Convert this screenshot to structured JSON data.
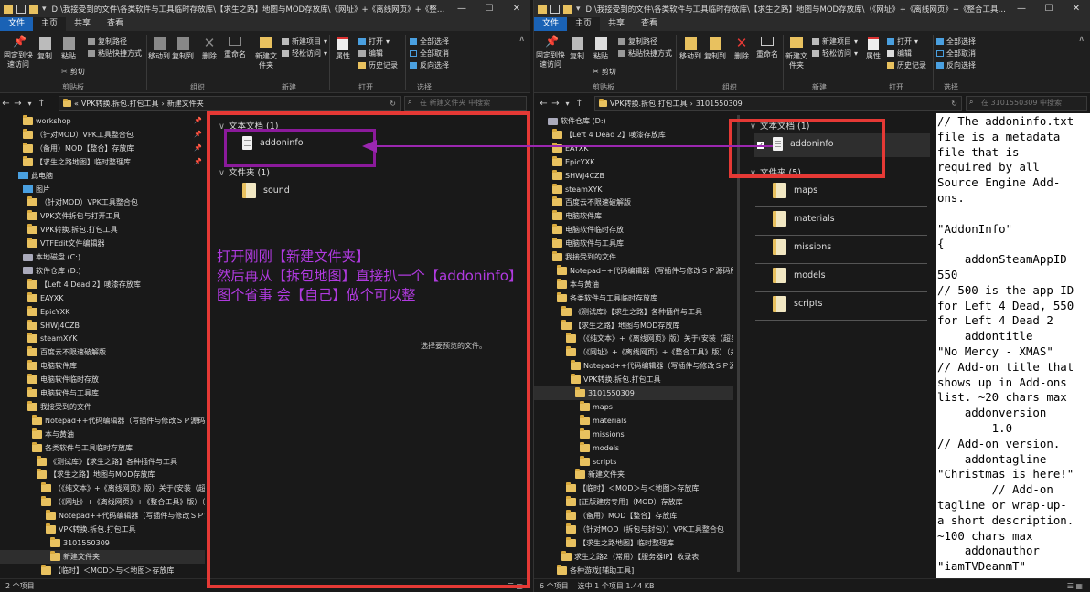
{
  "left_window": {
    "title": "D:\\我接受到的文件\\各类软件与工具临时存放库\\【求生之路】地图与MOD存放库\\《网址》+《离线网页》+《整合工具》...",
    "tabs": [
      "文件",
      "主页",
      "共享",
      "查看"
    ],
    "ribbon": {
      "pin_label": "固定到快速访问",
      "copy_label": "复制",
      "paste_label": "粘贴",
      "copy_path": "复制路径",
      "paste_shortcut": "粘贴快捷方式",
      "cut": "剪切",
      "move_to": "移动到",
      "copy_to": "复制到",
      "delete": "删除",
      "rename": "重命名",
      "new_folder": "新建文件夹",
      "new_item": "新建项目",
      "easy_access": "轻松访问",
      "properties": "属性",
      "open": "打开",
      "edit": "编辑",
      "history": "历史记录",
      "select_all": "全部选择",
      "select_none": "全部取消",
      "invert_select": "反向选择",
      "group_clipboard": "剪贴板",
      "group_organize": "组织",
      "group_new": "新建",
      "group_open": "打开",
      "group_select": "选择"
    },
    "address": [
      "«",
      "VPK转换.拆包.打包工具",
      "›",
      "新建文件夹"
    ],
    "search_placeholder": "在 新建文件夹 中搜索",
    "tree": [
      "workshop",
      "（针对MOD）VPK工具整合包",
      "（备用）MOD【整合】存放库",
      "【求生之路地图】临时整理库",
      "此电脑",
      "图片",
      "（针对MOD）VPK工具整合包",
      "VPK文件拆包与打开工具",
      "VPK转换.拆包.打包工具",
      "VTFEdit文件编辑器",
      "本地磁盘 (C:)",
      "软件仓库 (D:)",
      "【Left 4 Dead 2】唛漆存放库",
      "EAYXK",
      "EpicYXK",
      "SHWJ4CZB",
      "steamXYK",
      "百度云不限速破解版",
      "电脑软件库",
      "电脑软件临时存放",
      "电脑软件与工具库",
      "我接受到的文件",
      "Notepad++代码编辑器（写插件与修改ＳＰ源码所用）",
      "本与黄油",
      "各类软件与工具临时存放库",
      "《测试库》【求生之路】各种插件与工具",
      "【求生之路】地图与MOD存放库",
      "（《纯文本》+《离线网页》版）关于(安装（超多）",
      "（《网址》+《离线网页》+《整合工具》版）（关于",
      "Notepad++代码编辑器（写插件与修改ＳＰ源码",
      "VPK转换.拆包.打包工具",
      "3101550309",
      "新建文件夹",
      "【临时】＜MOD＞与＜地图＞存放库"
    ],
    "groups": {
      "text_docs": "文本文档 (1)",
      "folders": "文件夹 (1)"
    },
    "files": {
      "addoninfo": "addoninfo",
      "sound": "sound"
    },
    "preview_text": "选择要预览的文件。",
    "status": "2 个项目"
  },
  "right_window": {
    "title": "D:\\我接受到的文件\\各类软件与工具临时存放库\\【求生之路】地图与MOD存放库\\（《网址》+《离线网页》+《整合工具》版）（关于...",
    "tabs": [
      "文件",
      "主页",
      "共享",
      "查看"
    ],
    "address": [
      "VPK转换.拆包.打包工具",
      "›",
      "3101550309"
    ],
    "search_placeholder": "在 3101550309 中搜索",
    "tree": [
      "软件仓库 (D:)",
      "【Left 4 Dead 2】唛漆存放库",
      "EAYXK",
      "EpicYXK",
      "SHWJ4CZB",
      "steamXYK",
      "百度云不限速破解版",
      "电脑软件库",
      "电脑软件临时存放",
      "电脑软件与工具库",
      "我接受到的文件",
      "Notepad++代码编辑器（写插件与修改ＳＰ源码所用）",
      "本与黄油",
      "各类软件与工具临时存放库",
      "《测试库》【求生之路】各种插件与工具",
      "【求生之路】地图与MOD存放库",
      "（《纯文本》+《离线网页》版）关于(安装（超多）",
      "（《网址》+《离线网页》+《整合工具》版）（关",
      "Notepad++代码编辑器（写插件与修改ＳＰ源码所",
      "VPK转换.拆包.打包工具",
      "3101550309",
      "maps",
      "materials",
      "missions",
      "models",
      "scripts",
      "新建文件夹",
      "【临时】＜MOD＞与＜地图＞存放库",
      "[正版建房专用]（MOD）存放库",
      "（备用）MOD【整合】存放库",
      "（针对MOD（拆包与封包））VPK工具整合包",
      "【求生之路地图】临时整理库",
      "求生之路2（常用）【服务器IP】收录表",
      "各种游戏[辅助工具]"
    ],
    "groups": {
      "text_docs": "文本文档 (1)",
      "folders": "文件夹 (5)"
    },
    "files": [
      "addoninfo",
      "maps",
      "materials",
      "missions",
      "models",
      "scripts"
    ],
    "status_items": "6 个项目",
    "status_selected": "选中 1 个项目  1.44 KB",
    "code_lines": [
      "// The addoninfo.txt",
      "file is a metadata",
      "file that is",
      "required by all",
      "Source Engine Add-",
      "ons.",
      "",
      "\"AddonInfo\"",
      "{",
      "    addonSteamAppID",
      "550",
      "// 500 is the app ID",
      "for Left 4 Dead, 550",
      "for Left 4 Dead 2",
      "    addontitle",
      "\"No Mercy - XMAS\"",
      "// Add-on title that",
      "shows up in Add-ons",
      "list. ~20 chars max",
      "    addonversion",
      "        1.0",
      "// Add-on version.",
      "    addontagline",
      "\"Christmas is here!\"",
      "        // Add-on",
      "tagline or wrap-up-",
      "a short description.",
      "~100 chars max",
      "    addonauthor",
      "\"iamTVDeanmT\""
    ]
  },
  "annotation": {
    "line1": "打开刚刚【新建文件夹】",
    "line2": "然后再从【拆包地图】直接扒一个【addoninfo】",
    "line3": "图个省事 会【自己】做个可以整",
    "color": "#b03adf",
    "box_color": "#e53935"
  }
}
